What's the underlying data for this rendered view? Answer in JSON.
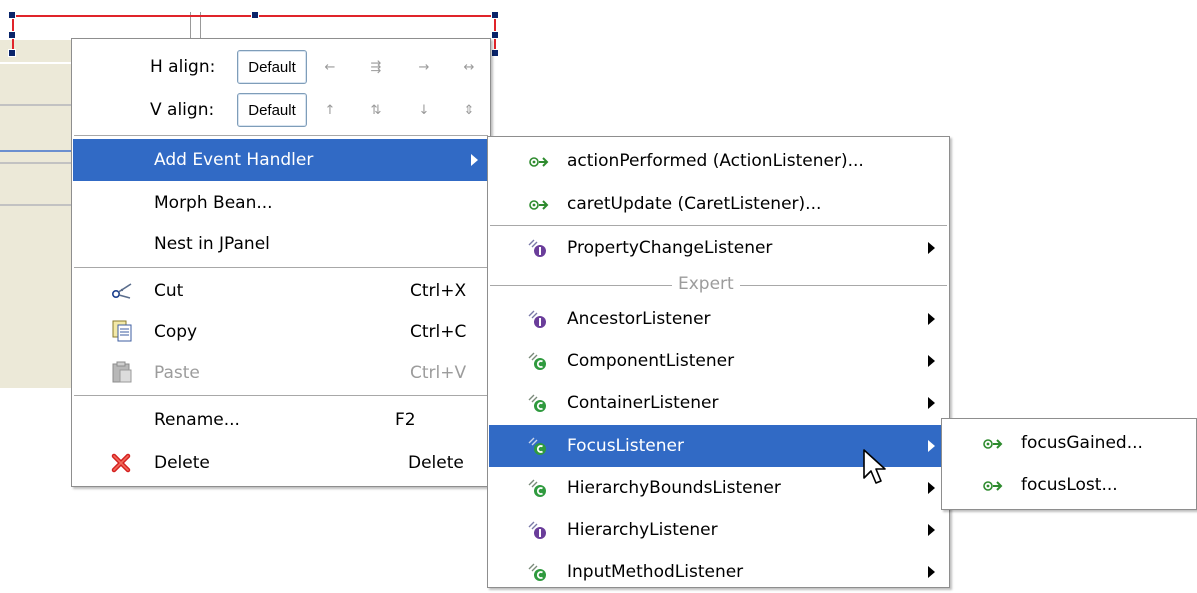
{
  "main_menu": {
    "h_align_label": "H align:",
    "v_align_label": "V align:",
    "h_align_value": "Default",
    "v_align_value": "Default",
    "items": [
      {
        "label": "Add Event Handler",
        "shortcut": ""
      },
      {
        "label": "Morph Bean...",
        "shortcut": ""
      },
      {
        "label": "Nest in JPanel",
        "shortcut": ""
      },
      {
        "label": "Cut",
        "shortcut": "Ctrl+X"
      },
      {
        "label": "Copy",
        "shortcut": "Ctrl+C"
      },
      {
        "label": "Paste",
        "shortcut": "Ctrl+V"
      },
      {
        "label": "Rename...",
        "shortcut": "F2"
      },
      {
        "label": "Delete",
        "shortcut": "Delete"
      }
    ]
  },
  "events_menu": {
    "items": [
      {
        "label": "actionPerformed (ActionListener)..."
      },
      {
        "label": "caretUpdate (CaretListener)..."
      },
      {
        "label": "PropertyChangeListener"
      },
      {
        "label": "AncestorListener"
      },
      {
        "label": "ComponentListener"
      },
      {
        "label": "ContainerListener"
      },
      {
        "label": "FocusListener"
      },
      {
        "label": "HierarchyBoundsListener"
      },
      {
        "label": "HierarchyListener"
      },
      {
        "label": "InputMethodListener"
      }
    ],
    "expert_label": "Expert"
  },
  "focus_menu": {
    "items": [
      {
        "label": "focusGained..."
      },
      {
        "label": "focusLost..."
      }
    ]
  },
  "colors": {
    "highlight": "#316ac5",
    "selection_line": "#e0242a",
    "event_icon_green": "#2e8b2e",
    "interface_icon_purple": "#6a3d9a"
  }
}
